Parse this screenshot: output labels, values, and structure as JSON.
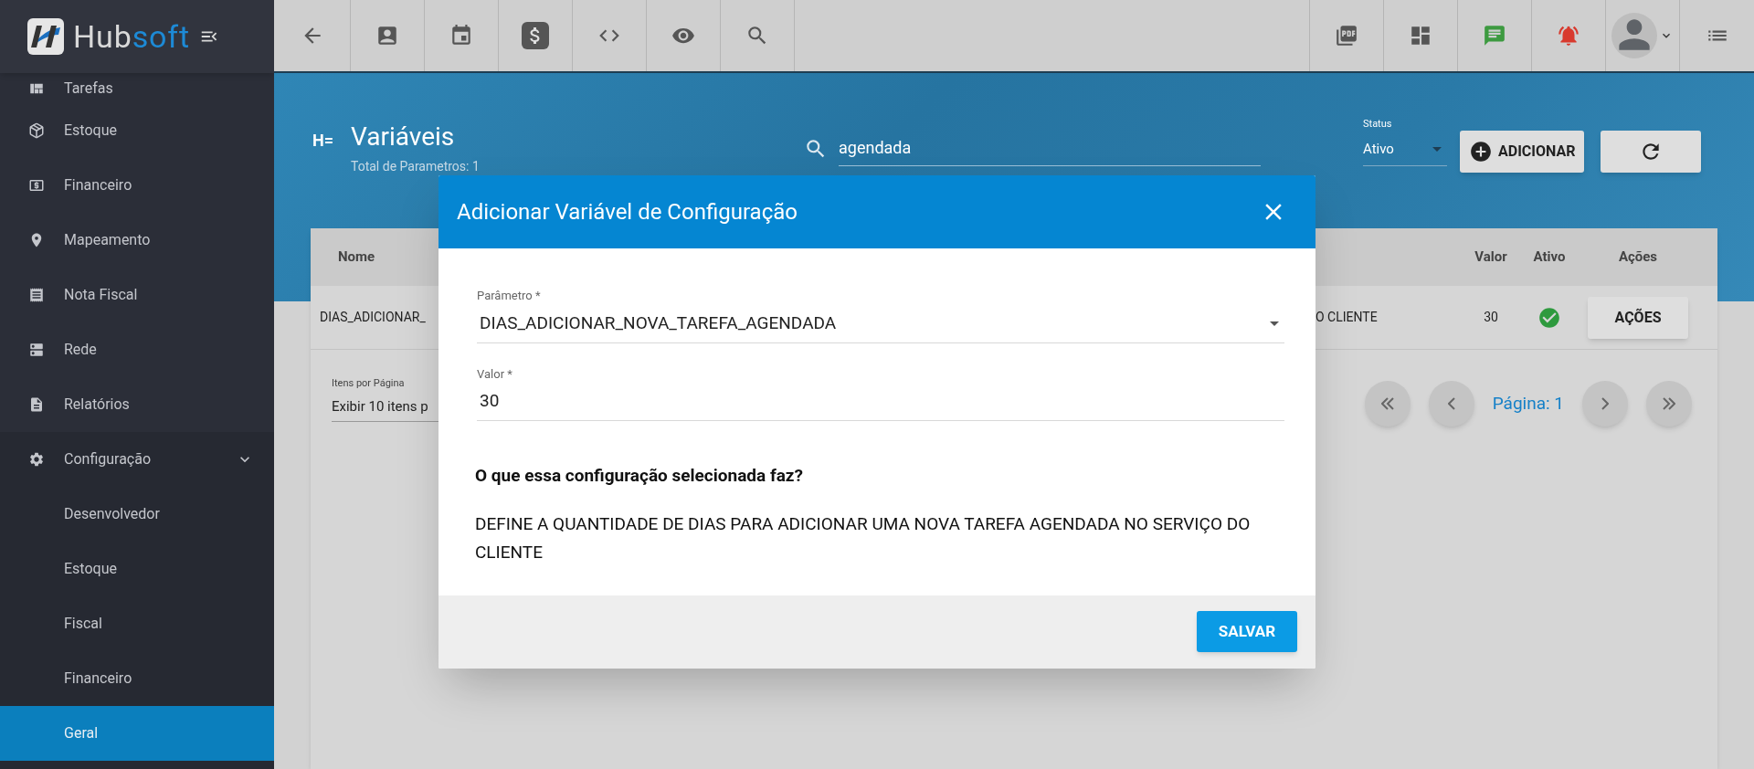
{
  "logo": {
    "part_a": "Hub",
    "part_b": "soft"
  },
  "sidebar": {
    "items": [
      {
        "label": "Tarefas",
        "selected": false
      },
      {
        "label": "Estoque",
        "selected": false
      },
      {
        "label": "Financeiro",
        "selected": false
      },
      {
        "label": "Mapeamento",
        "selected": false
      },
      {
        "label": "Nota Fiscal",
        "selected": false
      },
      {
        "label": "Rede",
        "selected": false
      },
      {
        "label": "Relatórios",
        "selected": false
      },
      {
        "label": "Configuração",
        "selected": false,
        "expanded": true,
        "children": [
          {
            "label": "Desenvolvedor",
            "selected": false
          },
          {
            "label": "Estoque",
            "selected": false
          },
          {
            "label": "Fiscal",
            "selected": false
          },
          {
            "label": "Financeiro",
            "selected": false
          },
          {
            "label": "Geral",
            "selected": true
          }
        ]
      }
    ]
  },
  "header": {
    "mark": "H=",
    "title": "Variáveis",
    "subtitle": "Total de Parametros: 1",
    "search": {
      "value": "agendada"
    },
    "status": {
      "label": "Status",
      "value": "Ativo"
    },
    "add_button": "ADICIONAR"
  },
  "table": {
    "columns": [
      {
        "label": "Nome"
      },
      {
        "label": "Valor"
      },
      {
        "label": "Ativo"
      },
      {
        "label": "Ações"
      }
    ],
    "rows": [
      {
        "name": "DIAS_ADICIONAR_",
        "description": "O CLIENTE",
        "value": "30",
        "active": true,
        "action": "AÇÕES"
      }
    ]
  },
  "pagination": {
    "per_page_label": "Itens por Página",
    "per_page_value": "Exibir 10 itens p",
    "page_label": "Página: 1"
  },
  "modal": {
    "title": "Adicionar Variável de Configuração",
    "fields": [
      {
        "kind": "select",
        "label": "Parâmetro *",
        "value": "DIAS_ADICIONAR_NOVA_TAREFA_AGENDADA"
      },
      {
        "kind": "text",
        "label": "Valor *",
        "value": "30"
      }
    ],
    "question": "O que essa configuração selecionada faz?",
    "description": "DEFINE A QUANTIDADE DE DIAS PARA ADICIONAR UMA NOVA TAREFA AGENDADA NO SERVIÇO DO CLIENTE",
    "save_button": "SALVAR"
  }
}
